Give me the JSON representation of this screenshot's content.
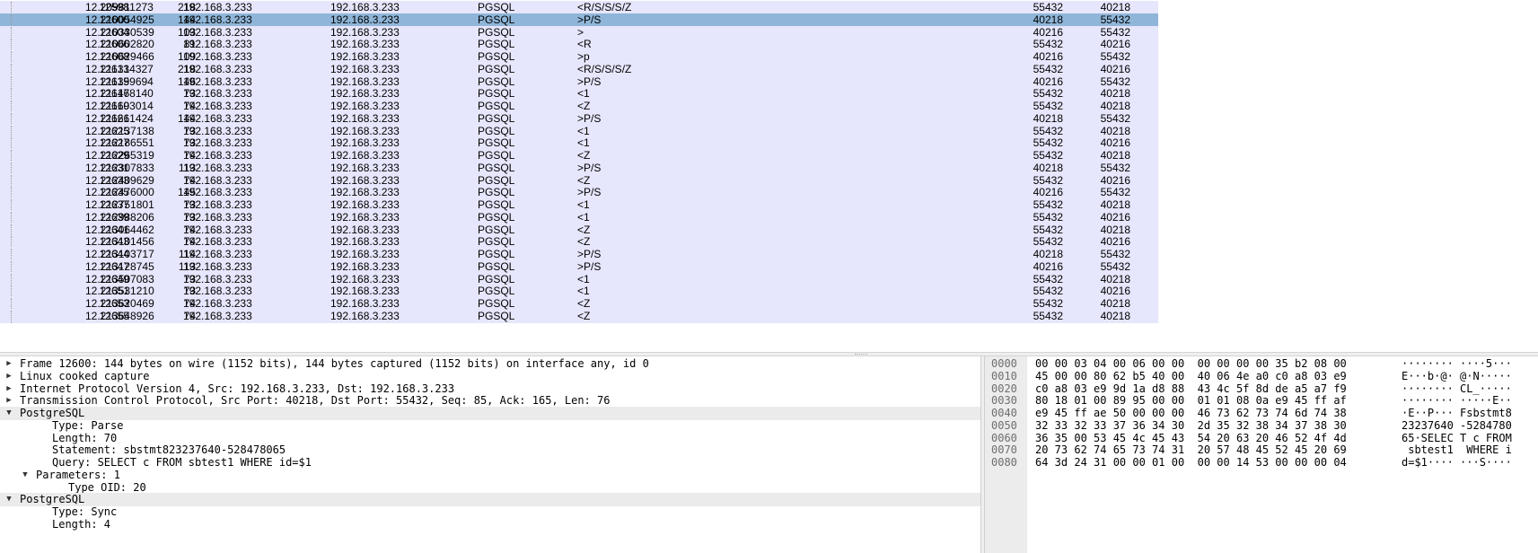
{
  "packet_list": {
    "rows": [
      {
        "no": "12598",
        "time": "12.209811273",
        "src": "192.168.3.233",
        "dst": "192.168.3.233",
        "proto": "PGSQL",
        "len": "218",
        "info": "<R/S/S/S/Z",
        "sport": "55432",
        "dport": "40218",
        "selected": false
      },
      {
        "no": "12600",
        "time": "12.210054925",
        "src": "192.168.3.233",
        "dst": "192.168.3.233",
        "proto": "PGSQL",
        "len": "144",
        "info": ">P/S",
        "sport": "40218",
        "dport": "55432",
        "selected": true
      },
      {
        "no": "12604",
        "time": "12.210330539",
        "src": "192.168.3.233",
        "dst": "192.168.3.233",
        "proto": "PGSQL",
        "len": "103",
        "info": ">",
        "sport": "40216",
        "dport": "55432",
        "selected": false
      },
      {
        "no": "12606",
        "time": "12.210602820",
        "src": "192.168.3.233",
        "dst": "192.168.3.233",
        "proto": "PGSQL",
        "len": "81",
        "info": "<R",
        "sport": "55432",
        "dport": "40216",
        "selected": false
      },
      {
        "no": "12608",
        "time": "12.210629466",
        "src": "192.168.3.233",
        "dst": "192.168.3.233",
        "proto": "PGSQL",
        "len": "109",
        "info": ">p",
        "sport": "40216",
        "dport": "55432",
        "selected": false
      },
      {
        "no": "12613",
        "time": "12.211314327",
        "src": "192.168.3.233",
        "dst": "192.168.3.233",
        "proto": "PGSQL",
        "len": "218",
        "info": "<R/S/S/S/Z",
        "sport": "55432",
        "dport": "40216",
        "selected": false
      },
      {
        "no": "12615",
        "time": "12.211399694",
        "src": "192.168.3.233",
        "dst": "192.168.3.233",
        "proto": "PGSQL",
        "len": "146",
        "info": ">P/S",
        "sport": "40216",
        "dport": "55432",
        "selected": false
      },
      {
        "no": "12617",
        "time": "12.211468140",
        "src": "192.168.3.233",
        "dst": "192.168.3.233",
        "proto": "PGSQL",
        "len": "73",
        "info": "<1",
        "sport": "55432",
        "dport": "40218",
        "selected": false
      },
      {
        "no": "12619",
        "time": "12.211603014",
        "src": "192.168.3.233",
        "dst": "192.168.3.233",
        "proto": "PGSQL",
        "len": "74",
        "info": "<Z",
        "sport": "55432",
        "dport": "40218",
        "selected": false
      },
      {
        "no": "12621",
        "time": "12.211661424",
        "src": "192.168.3.233",
        "dst": "192.168.3.233",
        "proto": "PGSQL",
        "len": "144",
        "info": ">P/S",
        "sport": "40218",
        "dport": "55432",
        "selected": false
      },
      {
        "no": "12625",
        "time": "12.212137138",
        "src": "192.168.3.233",
        "dst": "192.168.3.233",
        "proto": "PGSQL",
        "len": "73",
        "info": "<1",
        "sport": "55432",
        "dport": "40218",
        "selected": false
      },
      {
        "no": "12627",
        "time": "12.212186551",
        "src": "192.168.3.233",
        "dst": "192.168.3.233",
        "proto": "PGSQL",
        "len": "73",
        "info": "<1",
        "sport": "55432",
        "dport": "40216",
        "selected": false
      },
      {
        "no": "12629",
        "time": "12.212265319",
        "src": "192.168.3.233",
        "dst": "192.168.3.233",
        "proto": "PGSQL",
        "len": "74",
        "info": "<Z",
        "sport": "55432",
        "dport": "40218",
        "selected": false
      },
      {
        "no": "12631",
        "time": "12.212307833",
        "src": "192.168.3.233",
        "dst": "192.168.3.233",
        "proto": "PGSQL",
        "len": "113",
        "info": ">P/S",
        "sport": "40218",
        "dport": "55432",
        "selected": false
      },
      {
        "no": "12633",
        "time": "12.212409629",
        "src": "192.168.3.233",
        "dst": "192.168.3.233",
        "proto": "PGSQL",
        "len": "74",
        "info": "<Z",
        "sport": "55432",
        "dport": "40216",
        "selected": false
      },
      {
        "no": "12635",
        "time": "12.212476000",
        "src": "192.168.3.233",
        "dst": "192.168.3.233",
        "proto": "PGSQL",
        "len": "145",
        "info": ">P/S",
        "sport": "40216",
        "dport": "55432",
        "selected": false
      },
      {
        "no": "12637",
        "time": "12.212751801",
        "src": "192.168.3.233",
        "dst": "192.168.3.233",
        "proto": "PGSQL",
        "len": "73",
        "info": "<1",
        "sport": "55432",
        "dport": "40218",
        "selected": false
      },
      {
        "no": "12639",
        "time": "12.212988206",
        "src": "192.168.3.233",
        "dst": "192.168.3.233",
        "proto": "PGSQL",
        "len": "73",
        "info": "<1",
        "sport": "55432",
        "dport": "40216",
        "selected": false
      },
      {
        "no": "12641",
        "time": "12.213064462",
        "src": "192.168.3.233",
        "dst": "192.168.3.233",
        "proto": "PGSQL",
        "len": "74",
        "info": "<Z",
        "sport": "55432",
        "dport": "40218",
        "selected": false
      },
      {
        "no": "12643",
        "time": "12.213101456",
        "src": "192.168.3.233",
        "dst": "192.168.3.233",
        "proto": "PGSQL",
        "len": "74",
        "info": "<Z",
        "sport": "55432",
        "dport": "40216",
        "selected": false
      },
      {
        "no": "12644",
        "time": "12.213103717",
        "src": "192.168.3.233",
        "dst": "192.168.3.233",
        "proto": "PGSQL",
        "len": "114",
        "info": ">P/S",
        "sport": "40218",
        "dport": "55432",
        "selected": false
      },
      {
        "no": "12647",
        "time": "12.213128745",
        "src": "192.168.3.233",
        "dst": "192.168.3.233",
        "proto": "PGSQL",
        "len": "113",
        "info": ">P/S",
        "sport": "40216",
        "dport": "55432",
        "selected": false
      },
      {
        "no": "12649",
        "time": "12.213507083",
        "src": "192.168.3.233",
        "dst": "192.168.3.233",
        "proto": "PGSQL",
        "len": "73",
        "info": "<1",
        "sport": "55432",
        "dport": "40218",
        "selected": false
      },
      {
        "no": "12651",
        "time": "12.213531210",
        "src": "192.168.3.233",
        "dst": "192.168.3.233",
        "proto": "PGSQL",
        "len": "73",
        "info": "<1",
        "sport": "55432",
        "dport": "40216",
        "selected": false
      },
      {
        "no": "12653",
        "time": "12.213620469",
        "src": "192.168.3.233",
        "dst": "192.168.3.233",
        "proto": "PGSQL",
        "len": "74",
        "info": "<Z",
        "sport": "55432",
        "dport": "40218",
        "selected": false
      },
      {
        "no": "12655",
        "time": "12.213648926",
        "src": "192.168.3.233",
        "dst": "192.168.3.233",
        "proto": "PGSQL",
        "len": "74",
        "info": "<Z",
        "sport": "55432",
        "dport": "40218",
        "selected": false
      }
    ]
  },
  "details": {
    "rows": [
      {
        "text": "Frame 12600: 144 bytes on wire (1152 bits), 144 bytes captured (1152 bits) on interface any, id 0",
        "indent": 0,
        "arrow": "collapsed",
        "shaded": false
      },
      {
        "text": "Linux cooked capture",
        "indent": 0,
        "arrow": "collapsed",
        "shaded": false
      },
      {
        "text": "Internet Protocol Version 4, Src: 192.168.3.233, Dst: 192.168.3.233",
        "indent": 0,
        "arrow": "collapsed",
        "shaded": false
      },
      {
        "text": "Transmission Control Protocol, Src Port: 40218, Dst Port: 55432, Seq: 85, Ack: 165, Len: 76",
        "indent": 0,
        "arrow": "collapsed",
        "shaded": false
      },
      {
        "text": "PostgreSQL",
        "indent": 0,
        "arrow": "expanded",
        "shaded": true
      },
      {
        "text": "Type: Parse",
        "indent": 2,
        "arrow": "none",
        "shaded": false
      },
      {
        "text": "Length: 70",
        "indent": 2,
        "arrow": "none",
        "shaded": false
      },
      {
        "text": "Statement: sbstmt823237640-528478065",
        "indent": 2,
        "arrow": "none",
        "shaded": false
      },
      {
        "text": "Query: SELECT c FROM sbtest1 WHERE id=$1",
        "indent": 2,
        "arrow": "none",
        "shaded": false
      },
      {
        "text": "Parameters: 1",
        "indent": 1,
        "arrow": "expanded",
        "shaded": false
      },
      {
        "text": "Type OID: 20",
        "indent": 3,
        "arrow": "none",
        "shaded": false
      },
      {
        "text": "PostgreSQL",
        "indent": 0,
        "arrow": "expanded",
        "shaded": true
      },
      {
        "text": "Type: Sync",
        "indent": 2,
        "arrow": "none",
        "shaded": false
      },
      {
        "text": "Length: 4",
        "indent": 2,
        "arrow": "none",
        "shaded": false
      }
    ]
  },
  "bytes": {
    "rows": [
      {
        "offset": "0000",
        "hex": "00 00 03 04 00 06 00 00  00 00 00 00 35 b2 08 00",
        "ascii": "········ ····5···"
      },
      {
        "offset": "0010",
        "hex": "45 00 00 80 62 b5 40 00  40 06 4e a0 c0 a8 03 e9",
        "ascii": "E···b·@· @·N·····"
      },
      {
        "offset": "0020",
        "hex": "c0 a8 03 e9 9d 1a d8 88  43 4c 5f 8d de a5 a7 f9",
        "ascii": "········ CL_·····"
      },
      {
        "offset": "0030",
        "hex": "80 18 01 00 89 95 00 00  01 01 08 0a e9 45 ff af",
        "ascii": "········ ·····E··"
      },
      {
        "offset": "0040",
        "hex": "e9 45 ff ae 50 00 00 00  46 73 62 73 74 6d 74 38",
        "ascii": "·E··P··· Fsbstmt8"
      },
      {
        "offset": "0050",
        "hex": "32 33 32 33 37 36 34 30  2d 35 32 38 34 37 38 30",
        "ascii": "23237640 -5284780"
      },
      {
        "offset": "0060",
        "hex": "36 35 00 53 45 4c 45 43  54 20 63 20 46 52 4f 4d",
        "ascii": "65·SELEC T c FROM"
      },
      {
        "offset": "0070",
        "hex": "20 73 62 74 65 73 74 31  20 57 48 45 52 45 20 69",
        "ascii": " sbtest1  WHERE i"
      },
      {
        "offset": "0080",
        "hex": "64 3d 24 31 00 00 01 00  00 00 14 53 00 00 00 04",
        "ascii": "d=$1···· ···S····"
      }
    ]
  }
}
